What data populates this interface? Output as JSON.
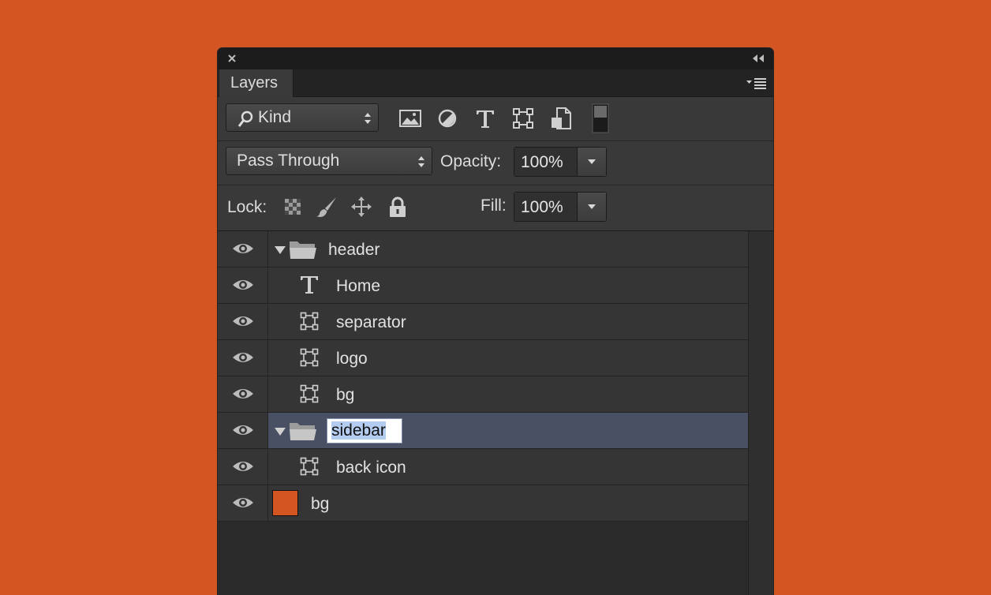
{
  "panel": {
    "tab_label": "Layers",
    "filter": {
      "kind_label": "Kind",
      "icons": [
        "pixel-filter-icon",
        "adjustment-filter-icon",
        "type-filter-icon",
        "shape-filter-icon",
        "smart-object-filter-icon",
        "filter-toggle-switch"
      ]
    },
    "blend": {
      "mode": "Pass Through",
      "opacity_label": "Opacity:",
      "opacity_value": "100%"
    },
    "lock": {
      "label": "Lock:",
      "icons": [
        "lock-transparent-pixels-icon",
        "lock-image-pixels-icon",
        "lock-position-icon",
        "lock-all-icon"
      ],
      "fill_label": "Fill:",
      "fill_value": "100%"
    },
    "layers": [
      {
        "name": "header",
        "kind": "group",
        "expanded": true
      },
      {
        "name": "Home",
        "kind": "type"
      },
      {
        "name": "separator",
        "kind": "shape"
      },
      {
        "name": "logo",
        "kind": "shape"
      },
      {
        "name": "bg",
        "kind": "shape"
      },
      {
        "name": "sidebar",
        "kind": "group",
        "expanded": true,
        "selected": true,
        "editing": true
      },
      {
        "name": "back icon",
        "kind": "shape"
      },
      {
        "name": "bg",
        "kind": "fill",
        "swatch_color": "#d35522"
      }
    ]
  },
  "colors": {
    "background": "#d35522",
    "panel": "#2d2d2d",
    "selected_row": "#4a5063"
  }
}
